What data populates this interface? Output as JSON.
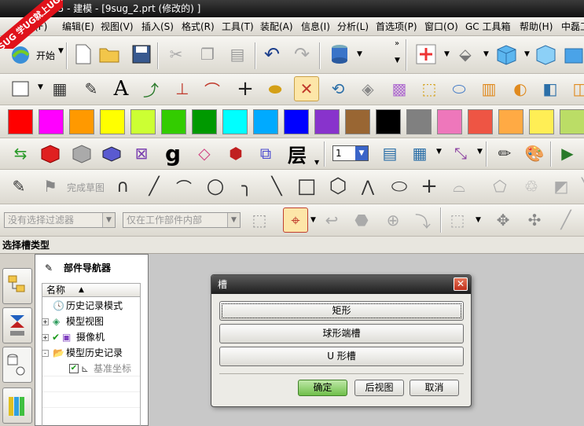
{
  "window": {
    "title": "25 - 建模 - [9sug_2.prt (修改的) ]",
    "logo_text": "9SUG 学UG就上UG网"
  },
  "menu": [
    "文件(F)",
    "编辑(E)",
    "视图(V)",
    "插入(S)",
    "格式(R)",
    "工具(T)",
    "装配(A)",
    "信息(I)",
    "分析(L)",
    "首选项(P)",
    "窗口(O)",
    "GC 工具箱",
    "帮助(H)",
    "中磊工"
  ],
  "toolbar1": {
    "start_label": "开始"
  },
  "toolbar4": {
    "layer_value": "1"
  },
  "toolbar5": {
    "finish_sketch_label": "完成草图"
  },
  "toolbar6": {
    "filter_placeholder": "没有选择过滤器",
    "scope_placeholder": "仅在工作部件内部"
  },
  "palette": [
    "#ff0000",
    "#ff00ff",
    "#ff9900",
    "#ffff00",
    "#ccff33",
    "#33cc00",
    "#009900",
    "#00ffff",
    "#00aaff",
    "#0000ff",
    "#8833cc",
    "#996633",
    "#000000",
    "#808080",
    "#ee77bb",
    "#ee5544",
    "#ffaa44",
    "#ffee55",
    "#bbdd66"
  ],
  "status": {
    "prompt": "选择槽类型"
  },
  "navigator": {
    "title": "部件导航器",
    "column_header": "名称",
    "rows": [
      {
        "label": "历史记录模式",
        "expander": ""
      },
      {
        "label": "模型视图",
        "expander": "+"
      },
      {
        "label": "摄像机",
        "expander": "+"
      },
      {
        "label": "模型历史记录",
        "expander": "-"
      },
      {
        "label": "基准坐标",
        "expander": ""
      }
    ]
  },
  "dialog": {
    "title": "槽",
    "options": [
      "矩形",
      "球形端槽",
      "U 形槽"
    ],
    "ok_label": "确定",
    "back_label": "后视图",
    "cancel_label": "取消"
  }
}
